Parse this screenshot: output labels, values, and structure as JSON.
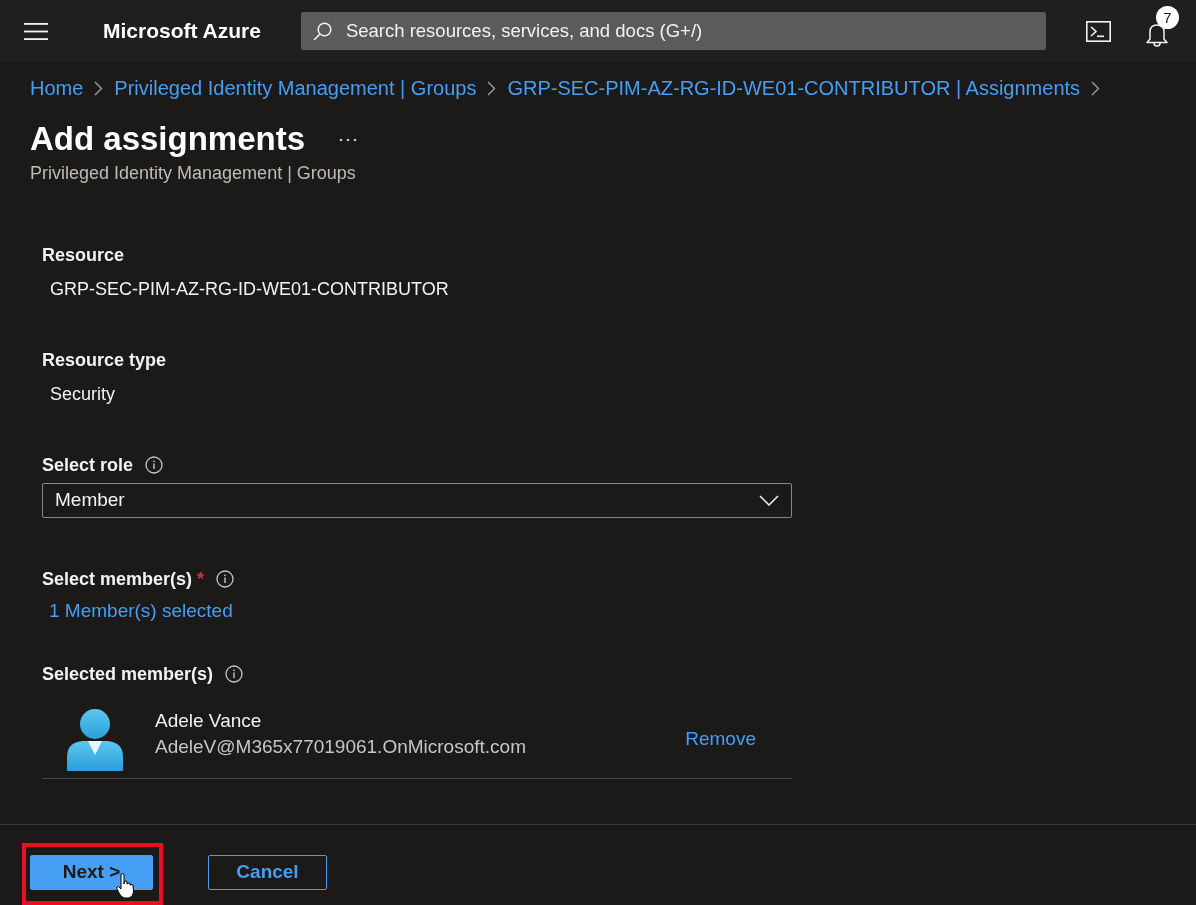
{
  "topbar": {
    "title": "Microsoft Azure",
    "search": {
      "placeholder": "Search resources, services, and docs (G+/)"
    },
    "notifications": {
      "count": "7"
    }
  },
  "breadcrumb": [
    {
      "label": "Home"
    },
    {
      "label": "Privileged Identity Management | Groups"
    },
    {
      "label": "GRP-SEC-PIM-AZ-RG-ID-WE01-CONTRIBUTOR | Assignments"
    }
  ],
  "header": {
    "title": "Add assignments",
    "subtitle": "Privileged Identity Management | Groups"
  },
  "fields": [
    {
      "kind": "text",
      "label": "Resource",
      "info": false,
      "value": "GRP-SEC-PIM-AZ-RG-ID-WE01-CONTRIBUTOR"
    },
    {
      "kind": "text",
      "label": "Resource type",
      "info": false,
      "value": "Security"
    },
    {
      "kind": "dropdown",
      "label": "Select role",
      "info": true,
      "value": "Member"
    },
    {
      "kind": "link",
      "label": "Select member(s)",
      "required_mark": "*",
      "info": true,
      "value": "1 Member(s) selected"
    },
    {
      "kind": "members",
      "label": "Selected member(s)",
      "info": true,
      "members": [
        {
          "name": "Adele Vance",
          "email": "AdeleV@M365x77019061.OnMicrosoft.com",
          "action": "Remove"
        }
      ]
    }
  ],
  "footer": {
    "buttons": [
      {
        "kind": "primary",
        "label": "Next >",
        "highlighted": true,
        "pointer": true
      },
      {
        "kind": "secondary",
        "label": "Cancel",
        "highlighted": false,
        "pointer": false
      }
    ]
  }
}
